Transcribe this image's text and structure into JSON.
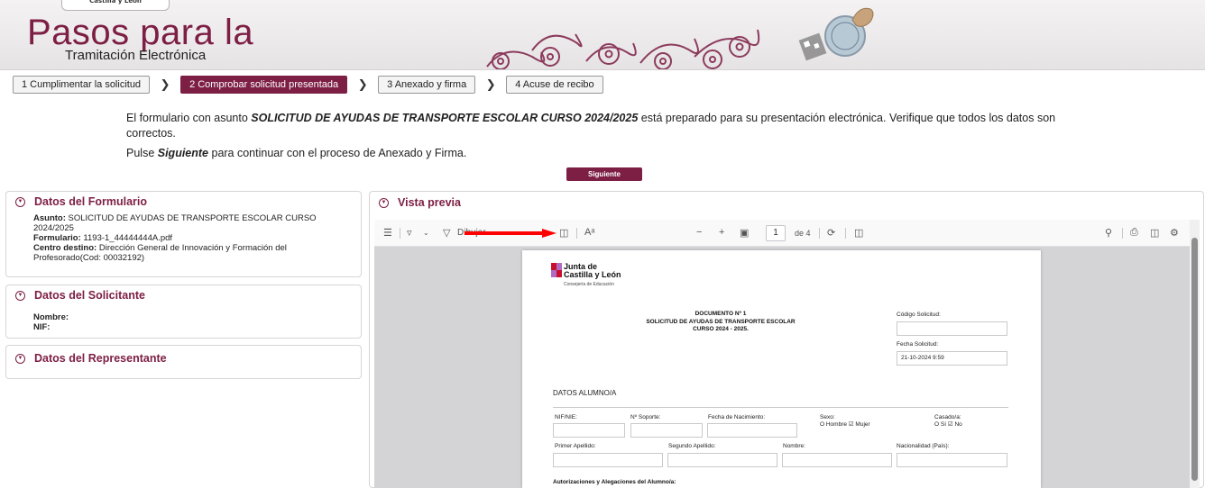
{
  "header": {
    "top_tab": "Castilla y León",
    "title": "Pasos para la",
    "subtitle": "Tramitación Electrónica"
  },
  "steps": [
    {
      "label": "1 Cumplimentar la solicitud"
    },
    {
      "label": "2 Comprobar solicitud presentada"
    },
    {
      "label": "3 Anexado y firma"
    },
    {
      "label": "4 Acuse de recibo"
    }
  ],
  "message": {
    "line1_prefix": "El formulario con asunto ",
    "line1_subject": "SOLICITUD DE AYUDAS DE TRANSPORTE ESCOLAR CURSO 2024/2025",
    "line1_suffix": " está preparado para su presentación electrónica. Verifique que todos los datos son correctos.",
    "line2_prefix": "Pulse ",
    "line2_bold": "Siguiente",
    "line2_suffix": " para continuar con el proceso de Anexado y Firma.",
    "next_button": "Siguiente"
  },
  "panels": {
    "formulario": {
      "title": "Datos del Formulario",
      "asunto_label": "Asunto:",
      "asunto_value": " SOLICITUD DE AYUDAS DE TRANSPORTE ESCOLAR CURSO 2024/2025",
      "formulario_label": "Formulario:",
      "formulario_value": " 1193-1_44444444A.pdf",
      "centro_label": "Centro destino:",
      "centro_value": " Dirección General de Innovación y Formación del Profesorado(Cod: 00032192)"
    },
    "solicitante": {
      "title": "Datos del Solicitante",
      "nombre_label": "Nombre:",
      "nif_label": "NIF:"
    },
    "representante": {
      "title": "Datos del Representante"
    }
  },
  "preview": {
    "title": "Vista previa",
    "toolbar": {
      "draw_label": "Dibujar",
      "page_number": "1",
      "page_total": "de 4",
      "minus": "−",
      "plus": "+"
    }
  },
  "document": {
    "logo_line1": "Junta de",
    "logo_line2": "Castilla y León",
    "logo_line3": "Consejería de Educación",
    "heading1": "DOCUMENTO Nº 1",
    "heading2": "SOLICITUD DE AYUDAS DE TRANSPORTE ESCOLAR",
    "heading3": "CURSO 2024 - 2025.",
    "codigo_label": "Código Solicitud:",
    "fecha_label": "Fecha Solicitud:",
    "fecha_value": "21-10-2024 9:59",
    "section_title": "DATOS ALUMNO/A",
    "nif_label": "NIF/NIE:",
    "soporte_label": "Nº Soporte:",
    "nacimiento_label": "Fecha de Nacimiento:",
    "sexo_label": "Sexo:",
    "sexo_options": "O Hombre  ☑ Mujer",
    "casado_label": "Casado/a:",
    "casado_options": "O Sí  ☑ No",
    "primer_apellido_label": "Primer Apellido:",
    "segundo_apellido_label": "Segundo Apellido:",
    "nombre_label": "Nombre:",
    "nacionalidad_label": "Nacionalidad (País):",
    "next_section": "Autorizaciones y Alegaciones del Alumno/a:"
  },
  "colors": {
    "brand": "#7d1e44",
    "arrow": "#ff0000"
  }
}
